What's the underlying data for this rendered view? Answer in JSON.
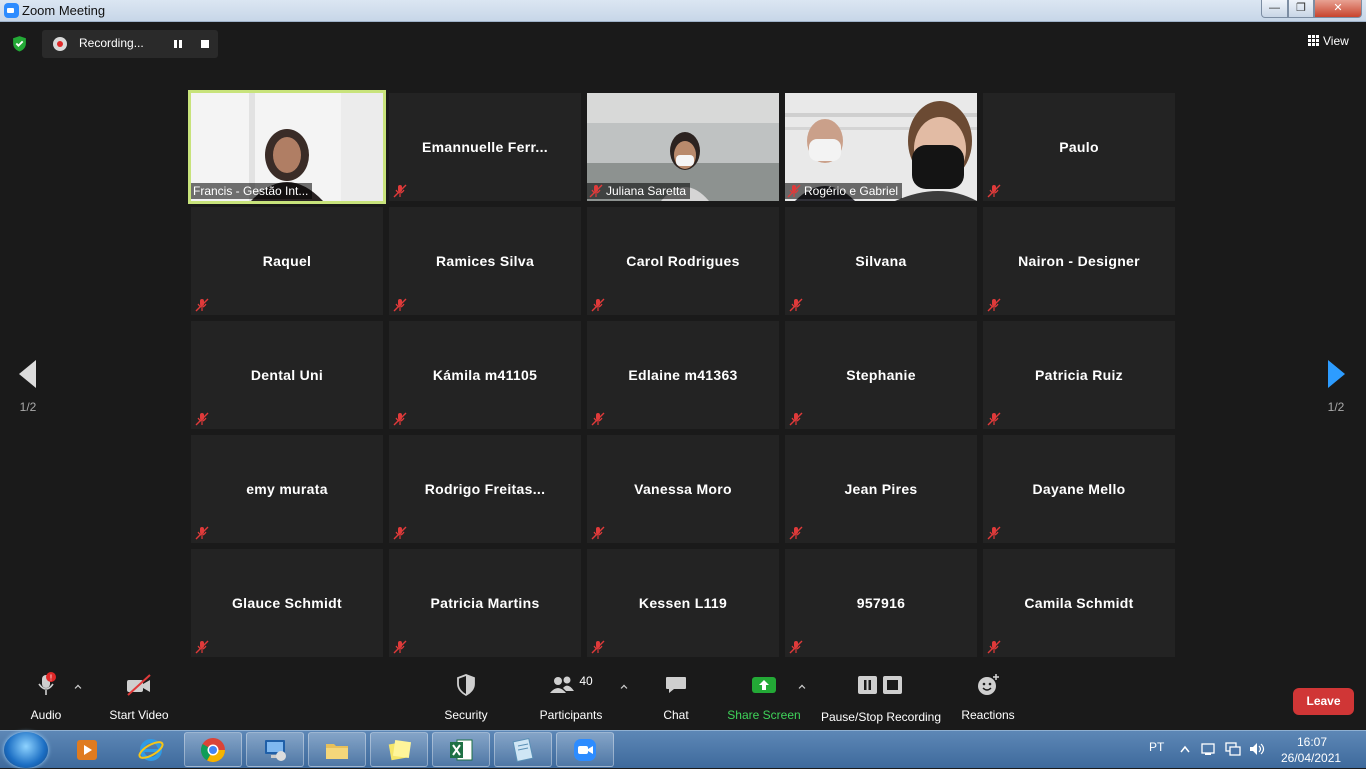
{
  "window": {
    "title": "Zoom Meeting",
    "minimize": "—",
    "maximize": "❐",
    "close": "✕"
  },
  "topbar": {
    "recording_label": "Recording...",
    "view_label": "View"
  },
  "participants": [
    {
      "name": "Francis - Gestão Int...",
      "video": true,
      "active": true
    },
    {
      "name": "Emannuelle  Ferr...",
      "video": false
    },
    {
      "name": "Juliana Saretta",
      "video": true
    },
    {
      "name": "Rogério e Gabriel",
      "video": true
    },
    {
      "name": "Paulo",
      "video": false
    },
    {
      "name": "Raquel",
      "video": false
    },
    {
      "name": "Ramices Silva",
      "video": false
    },
    {
      "name": "Carol Rodrigues",
      "video": false
    },
    {
      "name": "Silvana",
      "video": false
    },
    {
      "name": "Nairon - Designer",
      "video": false
    },
    {
      "name": "Dental Uni",
      "video": false
    },
    {
      "name": "Kámila m41105",
      "video": false
    },
    {
      "name": "Edlaine m41363",
      "video": false
    },
    {
      "name": "Stephanie",
      "video": false
    },
    {
      "name": "Patricia Ruiz",
      "video": false
    },
    {
      "name": "emy murata",
      "video": false
    },
    {
      "name": "Rodrigo  Freitas...",
      "video": false
    },
    {
      "name": "Vanessa Moro",
      "video": false
    },
    {
      "name": "Jean Pires",
      "video": false
    },
    {
      "name": "Dayane Mello",
      "video": false
    },
    {
      "name": "Glauce Schmidt",
      "video": false
    },
    {
      "name": "Patricia Martins",
      "video": false
    },
    {
      "name": "Kessen L119",
      "video": false
    },
    {
      "name": "957916",
      "video": false
    },
    {
      "name": "Camila Schmidt",
      "video": false
    }
  ],
  "pager": {
    "left": "1/2",
    "right": "1/2"
  },
  "toolbar": {
    "audio": "Audio",
    "start_video": "Start Video",
    "security": "Security",
    "participants": "Participants",
    "participants_count": "40",
    "chat": "Chat",
    "share_screen": "Share Screen",
    "pause_stop_recording": "Pause/Stop Recording",
    "reactions": "Reactions",
    "leave": "Leave",
    "audio_alert": "!"
  },
  "taskbar": {
    "language": "PT",
    "time": "16:07",
    "date": "26/04/2021"
  },
  "colors": {
    "active_border": "#c8e37b",
    "leave": "#d03636",
    "share": "#23a936",
    "accent": "#2d8cff",
    "muted_red": "#e03a3a"
  }
}
